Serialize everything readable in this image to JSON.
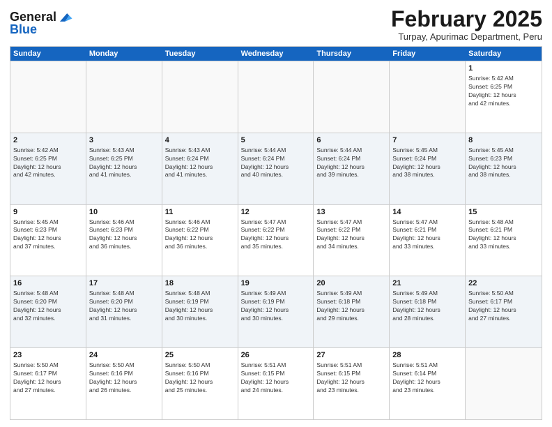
{
  "header": {
    "logo_line1": "General",
    "logo_line2": "Blue",
    "month": "February 2025",
    "location": "Turpay, Apurimac Department, Peru"
  },
  "weekdays": [
    "Sunday",
    "Monday",
    "Tuesday",
    "Wednesday",
    "Thursday",
    "Friday",
    "Saturday"
  ],
  "weeks": [
    [
      {
        "day": "",
        "info": ""
      },
      {
        "day": "",
        "info": ""
      },
      {
        "day": "",
        "info": ""
      },
      {
        "day": "",
        "info": ""
      },
      {
        "day": "",
        "info": ""
      },
      {
        "day": "",
        "info": ""
      },
      {
        "day": "1",
        "info": "Sunrise: 5:42 AM\nSunset: 6:25 PM\nDaylight: 12 hours\nand 42 minutes."
      }
    ],
    [
      {
        "day": "2",
        "info": "Sunrise: 5:42 AM\nSunset: 6:25 PM\nDaylight: 12 hours\nand 42 minutes."
      },
      {
        "day": "3",
        "info": "Sunrise: 5:43 AM\nSunset: 6:25 PM\nDaylight: 12 hours\nand 41 minutes."
      },
      {
        "day": "4",
        "info": "Sunrise: 5:43 AM\nSunset: 6:24 PM\nDaylight: 12 hours\nand 41 minutes."
      },
      {
        "day": "5",
        "info": "Sunrise: 5:44 AM\nSunset: 6:24 PM\nDaylight: 12 hours\nand 40 minutes."
      },
      {
        "day": "6",
        "info": "Sunrise: 5:44 AM\nSunset: 6:24 PM\nDaylight: 12 hours\nand 39 minutes."
      },
      {
        "day": "7",
        "info": "Sunrise: 5:45 AM\nSunset: 6:24 PM\nDaylight: 12 hours\nand 38 minutes."
      },
      {
        "day": "8",
        "info": "Sunrise: 5:45 AM\nSunset: 6:23 PM\nDaylight: 12 hours\nand 38 minutes."
      }
    ],
    [
      {
        "day": "9",
        "info": "Sunrise: 5:45 AM\nSunset: 6:23 PM\nDaylight: 12 hours\nand 37 minutes."
      },
      {
        "day": "10",
        "info": "Sunrise: 5:46 AM\nSunset: 6:23 PM\nDaylight: 12 hours\nand 36 minutes."
      },
      {
        "day": "11",
        "info": "Sunrise: 5:46 AM\nSunset: 6:22 PM\nDaylight: 12 hours\nand 36 minutes."
      },
      {
        "day": "12",
        "info": "Sunrise: 5:47 AM\nSunset: 6:22 PM\nDaylight: 12 hours\nand 35 minutes."
      },
      {
        "day": "13",
        "info": "Sunrise: 5:47 AM\nSunset: 6:22 PM\nDaylight: 12 hours\nand 34 minutes."
      },
      {
        "day": "14",
        "info": "Sunrise: 5:47 AM\nSunset: 6:21 PM\nDaylight: 12 hours\nand 33 minutes."
      },
      {
        "day": "15",
        "info": "Sunrise: 5:48 AM\nSunset: 6:21 PM\nDaylight: 12 hours\nand 33 minutes."
      }
    ],
    [
      {
        "day": "16",
        "info": "Sunrise: 5:48 AM\nSunset: 6:20 PM\nDaylight: 12 hours\nand 32 minutes."
      },
      {
        "day": "17",
        "info": "Sunrise: 5:48 AM\nSunset: 6:20 PM\nDaylight: 12 hours\nand 31 minutes."
      },
      {
        "day": "18",
        "info": "Sunrise: 5:48 AM\nSunset: 6:19 PM\nDaylight: 12 hours\nand 30 minutes."
      },
      {
        "day": "19",
        "info": "Sunrise: 5:49 AM\nSunset: 6:19 PM\nDaylight: 12 hours\nand 30 minutes."
      },
      {
        "day": "20",
        "info": "Sunrise: 5:49 AM\nSunset: 6:18 PM\nDaylight: 12 hours\nand 29 minutes."
      },
      {
        "day": "21",
        "info": "Sunrise: 5:49 AM\nSunset: 6:18 PM\nDaylight: 12 hours\nand 28 minutes."
      },
      {
        "day": "22",
        "info": "Sunrise: 5:50 AM\nSunset: 6:17 PM\nDaylight: 12 hours\nand 27 minutes."
      }
    ],
    [
      {
        "day": "23",
        "info": "Sunrise: 5:50 AM\nSunset: 6:17 PM\nDaylight: 12 hours\nand 27 minutes."
      },
      {
        "day": "24",
        "info": "Sunrise: 5:50 AM\nSunset: 6:16 PM\nDaylight: 12 hours\nand 26 minutes."
      },
      {
        "day": "25",
        "info": "Sunrise: 5:50 AM\nSunset: 6:16 PM\nDaylight: 12 hours\nand 25 minutes."
      },
      {
        "day": "26",
        "info": "Sunrise: 5:51 AM\nSunset: 6:15 PM\nDaylight: 12 hours\nand 24 minutes."
      },
      {
        "day": "27",
        "info": "Sunrise: 5:51 AM\nSunset: 6:15 PM\nDaylight: 12 hours\nand 23 minutes."
      },
      {
        "day": "28",
        "info": "Sunrise: 5:51 AM\nSunset: 6:14 PM\nDaylight: 12 hours\nand 23 minutes."
      },
      {
        "day": "",
        "info": ""
      }
    ]
  ]
}
